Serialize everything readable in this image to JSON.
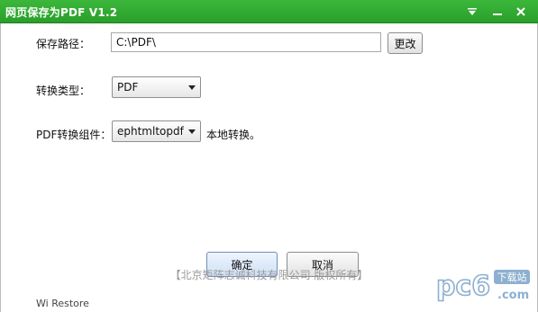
{
  "window": {
    "title": "网页保存为PDF  V1.2"
  },
  "form": {
    "save_path_label": "保存路径：",
    "save_path_value": "C:\\PDF\\",
    "change_button": "更改",
    "convert_type_label": "转换类型：",
    "convert_type_value": "PDF",
    "component_label": "PDF转换组件：",
    "component_value": "ephtmltopdf",
    "component_note": "本地转换。"
  },
  "actions": {
    "ok": "确定",
    "cancel": "取消"
  },
  "footer": {
    "copyright": "【北京矩阵志诚科技有限公司 版权所有】"
  },
  "background_fragment": {
    "text": "Wi Restore"
  },
  "watermark": {
    "logo_text": "pc6",
    "sub_text": "下载站",
    "domain": ".com"
  },
  "colors": {
    "titlebar": "#2fa92f",
    "watermark": "#7aa3c8"
  }
}
